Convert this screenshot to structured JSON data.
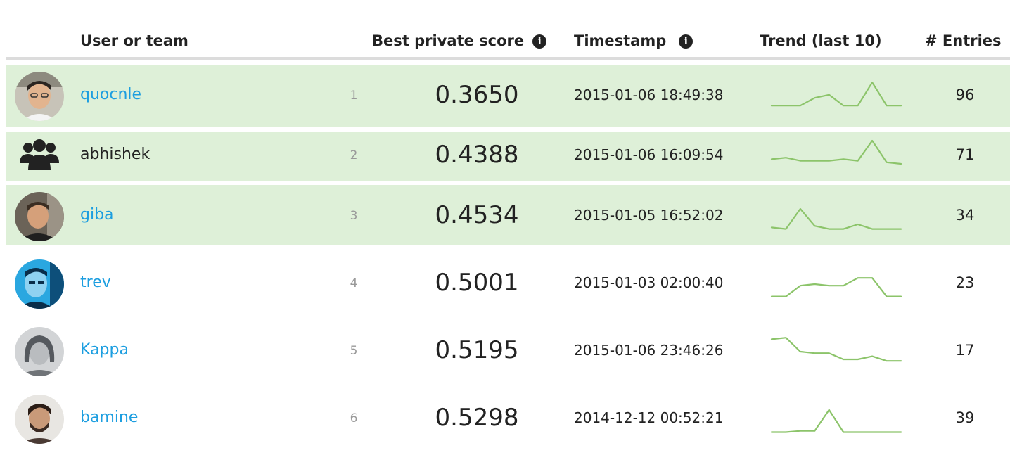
{
  "header": {
    "user_or_team": "User or team",
    "best_private_score": "Best private score",
    "timestamp": "Timestamp",
    "trend": "Trend (last 10)",
    "entries": "# Entries"
  },
  "colors": {
    "highlight_row": "#def0d8",
    "link": "#1c9ee0",
    "trend_line": "#8cc46a"
  },
  "rows": [
    {
      "rank": "1",
      "name": "quocnle",
      "score": "0.3650",
      "timestamp": "2015-01-06 18:49:38",
      "entries": "96",
      "highlighted": true,
      "is_team": false,
      "trend": [
        0.8,
        0.8,
        0.8,
        0.55,
        0.45,
        0.8,
        0.8,
        0.05,
        0.8,
        0.8
      ]
    },
    {
      "rank": "2",
      "name": "abhishek",
      "score": "0.4388",
      "timestamp": "2015-01-06 16:09:54",
      "entries": "71",
      "highlighted": true,
      "is_team": true,
      "trend": [
        0.6,
        0.55,
        0.65,
        0.65,
        0.65,
        0.6,
        0.65,
        0.0,
        0.7,
        0.75
      ]
    },
    {
      "rank": "3",
      "name": "giba",
      "score": "0.4534",
      "timestamp": "2015-01-05 16:52:02",
      "entries": "34",
      "highlighted": true,
      "is_team": false,
      "trend": [
        0.85,
        0.9,
        0.25,
        0.8,
        0.9,
        0.9,
        0.75,
        0.9,
        0.9,
        0.9
      ]
    },
    {
      "rank": "4",
      "name": "trev",
      "score": "0.5001",
      "timestamp": "2015-01-03 02:00:40",
      "entries": "23",
      "highlighted": false,
      "is_team": false,
      "trend": [
        0.9,
        0.9,
        0.55,
        0.5,
        0.55,
        0.55,
        0.3,
        0.3,
        0.9,
        0.9
      ]
    },
    {
      "rank": "5",
      "name": "Kappa",
      "score": "0.5195",
      "timestamp": "2015-01-06 23:46:26",
      "entries": "17",
      "highlighted": false,
      "is_team": false,
      "trend": [
        0.1,
        0.05,
        0.5,
        0.55,
        0.55,
        0.75,
        0.75,
        0.65,
        0.8,
        0.8
      ]
    },
    {
      "rank": "6",
      "name": "bamine",
      "score": "0.5298",
      "timestamp": "2014-12-12 00:52:21",
      "entries": "39",
      "highlighted": false,
      "is_team": false,
      "trend": [
        0.92,
        0.92,
        0.88,
        0.88,
        0.2,
        0.92,
        0.92,
        0.92,
        0.92,
        0.92
      ]
    }
  ]
}
